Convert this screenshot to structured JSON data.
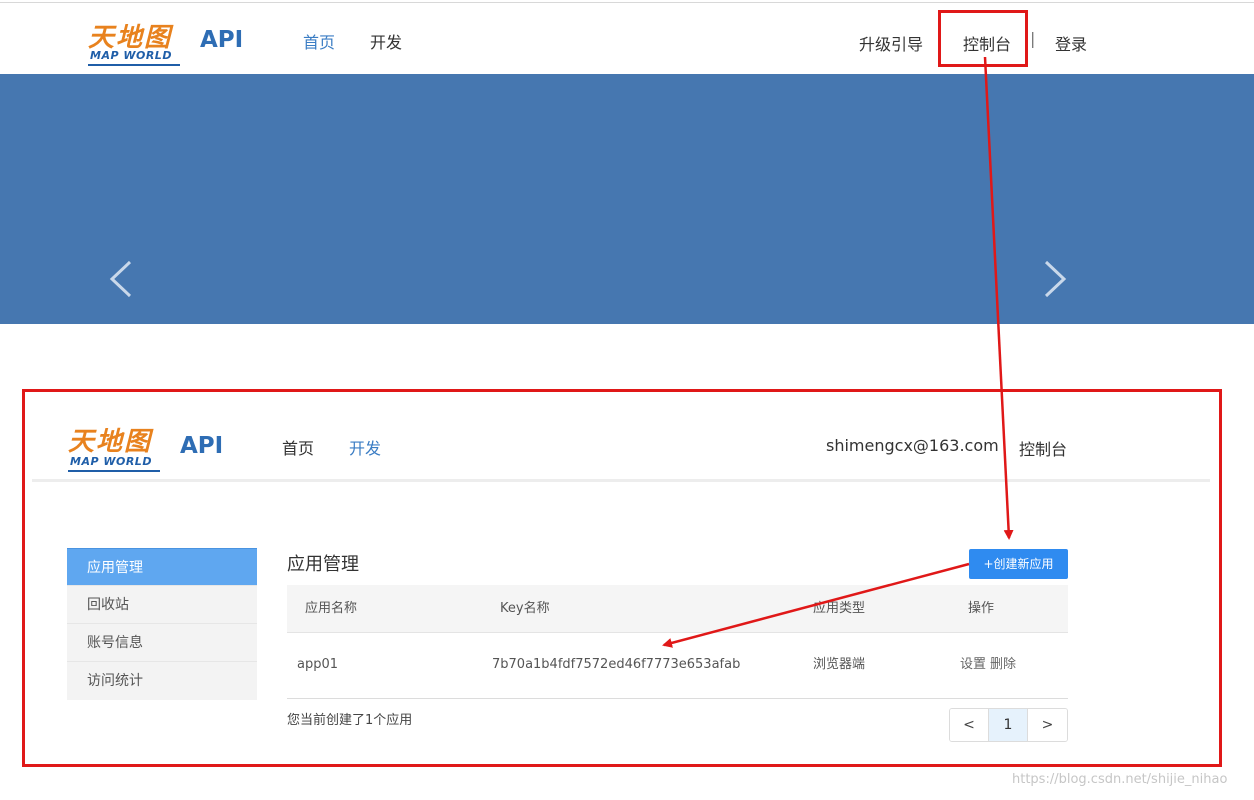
{
  "logo": {
    "cn": "天地图",
    "en": "MAP WORLD",
    "api": "API"
  },
  "header_top": {
    "nav": [
      "首页",
      "开发"
    ],
    "right": {
      "upgrade": "升级引导",
      "console": "控制台",
      "divider": "|",
      "login": "登录"
    }
  },
  "banner": {
    "color": "#4677b0",
    "prev_icon": "chevron-left-icon",
    "next_icon": "chevron-right-icon"
  },
  "header_console": {
    "nav": [
      "首页",
      "开发"
    ],
    "active_nav": "开发",
    "user_email": "shimengcx@163.com",
    "console": "控制台"
  },
  "sidebar": {
    "items": [
      "应用管理",
      "回收站",
      "账号信息",
      "访问统计"
    ],
    "active_index": 0
  },
  "app_management": {
    "title": "应用管理",
    "create_button": "+创建新应用",
    "columns": [
      "应用名称",
      "Key名称",
      "应用类型",
      "操作"
    ],
    "rows": [
      {
        "name": "app01",
        "key": "7b70a1b4fdf7572ed46f7773e653afab",
        "type": "浏览器端",
        "actions": [
          "设置",
          "删除"
        ]
      }
    ],
    "summary": "您当前创建了1个应用"
  },
  "pagination": {
    "prev": "<",
    "current": "1",
    "next": ">"
  },
  "watermark": "https://blog.csdn.net/shijie_nihao",
  "colors": {
    "highlight_red": "#e01818",
    "accent_blue": "#2f8bf0",
    "sidebar_active": "#5fa7f0"
  }
}
